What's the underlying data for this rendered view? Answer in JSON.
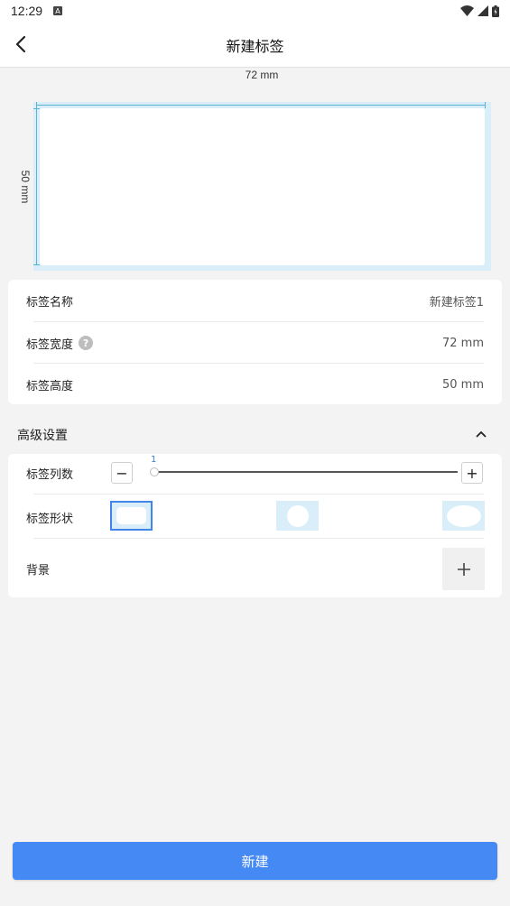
{
  "status_bar": {
    "time": "12:29",
    "notification_icon": "a-icon",
    "icons": [
      "wifi-icon",
      "signal-icon",
      "battery-icon"
    ]
  },
  "header": {
    "title": "新建标签",
    "back_icon": "chevron-left-icon"
  },
  "preview": {
    "width_label": "72 mm",
    "height_label": "50 mm"
  },
  "basic": {
    "name": {
      "label": "标签名称",
      "value": "新建标签1"
    },
    "width": {
      "label": "标签宽度",
      "help": "?",
      "value": "72 mm"
    },
    "height": {
      "label": "标签高度",
      "value": "50 mm"
    }
  },
  "advanced": {
    "title": "高级设置",
    "expanded": true,
    "columns": {
      "label": "标签列数",
      "value": "1",
      "minus": "−",
      "plus": "+"
    },
    "shape": {
      "label": "标签形状",
      "options": [
        "rounded-rect",
        "circle",
        "ellipse"
      ],
      "selected": "rounded-rect"
    },
    "background": {
      "label": "背景",
      "add": "+"
    }
  },
  "footer": {
    "create_label": "新建"
  },
  "colors": {
    "accent": "#4589f5",
    "preview_frame": "#d9eef8",
    "ruler": "#58b3d6",
    "page_bg": "#f3f3f3"
  }
}
